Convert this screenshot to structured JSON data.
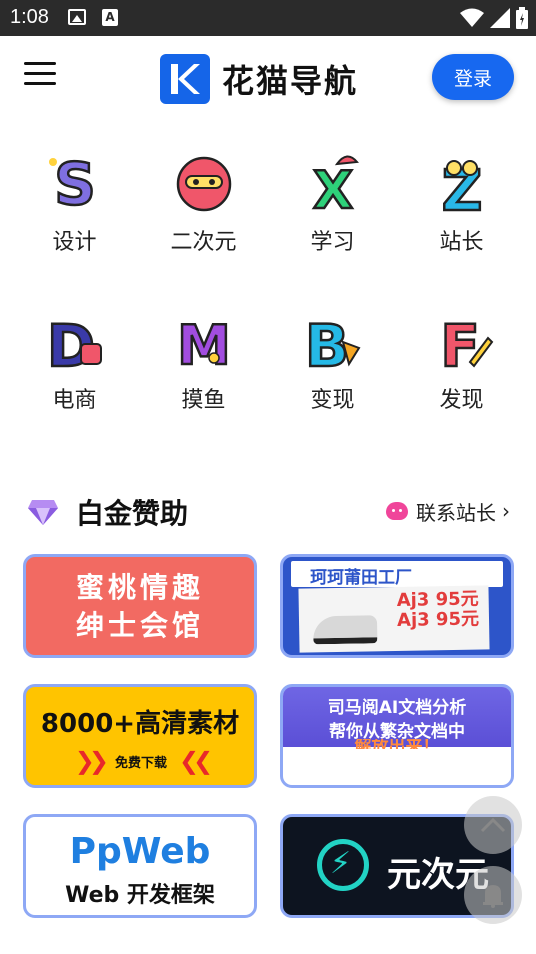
{
  "status_bar": {
    "time": "1:08"
  },
  "header": {
    "brand_name": "花猫导航",
    "login_label": "登录"
  },
  "categories": [
    {
      "label": "设计",
      "letter": "S",
      "color": "#7f6fe0"
    },
    {
      "label": "二次元",
      "letter": "e",
      "color": "#f0566a"
    },
    {
      "label": "学习",
      "letter": "X",
      "color": "#2ed17a"
    },
    {
      "label": "站长",
      "letter": "Z",
      "color": "#29b8e8"
    },
    {
      "label": "电商",
      "letter": "D",
      "color": "#3a3aa8"
    },
    {
      "label": "摸鱼",
      "letter": "M",
      "color": "#a24de0"
    },
    {
      "label": "变现",
      "letter": "B",
      "color": "#25b9e6"
    },
    {
      "label": "发现",
      "letter": "F",
      "color": "#f0566a"
    }
  ],
  "section": {
    "title": "白金赞助",
    "contact_label": "联系站长"
  },
  "ads": {
    "ad1": {
      "line1": "蜜桃情趣",
      "line2": "绅士会馆"
    },
    "ad2": {
      "banner": "珂珂莆田工厂",
      "price_line1": "Aj3 95元",
      "price_line2": "Aj3 95元"
    },
    "ad3": {
      "headline": "8000+高清素材",
      "cta": "免费下载"
    },
    "ad4": {
      "line1": "司马阅AI文档分析",
      "line2": "帮你从繁杂文档中",
      "line3": "解放出来！"
    },
    "ad5": {
      "line1": "PpWeb",
      "line2": "Web 开发框架"
    },
    "ad6": {
      "line1": "元次元"
    }
  },
  "icons": {
    "menu": "hamburger-menu-icon",
    "logo": "k-logo-icon",
    "diamond": "diamond-icon",
    "contact": "blob-face-icon",
    "chevron": "chevron-right-icon",
    "top": "arrow-up-icon",
    "bell": "bell-icon"
  }
}
